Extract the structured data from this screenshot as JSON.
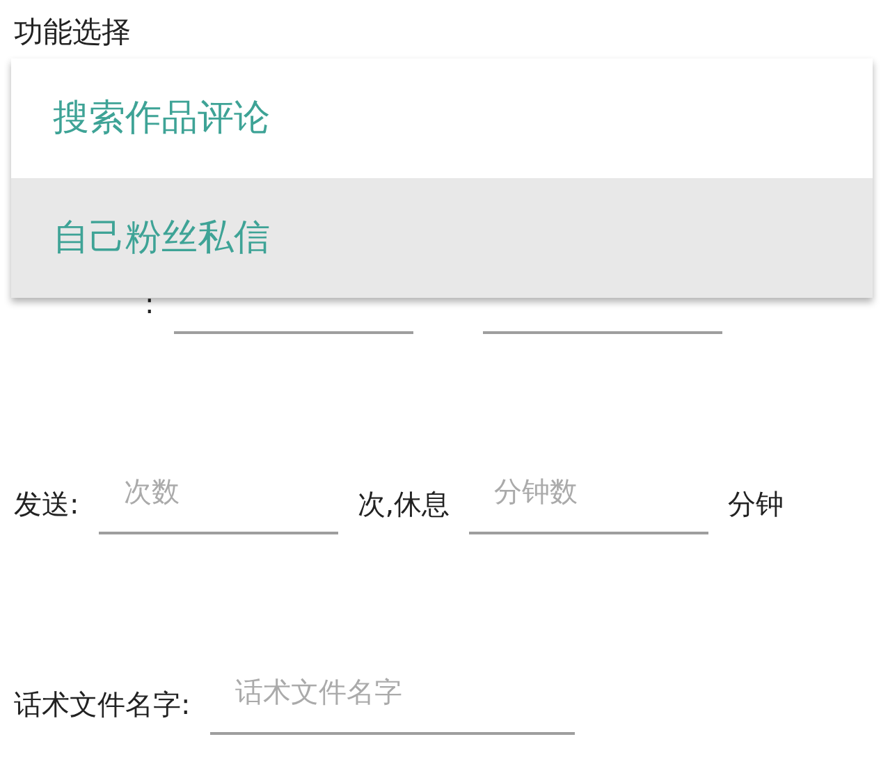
{
  "title": "功能选择",
  "dropdown": {
    "items": [
      {
        "label": "搜索作品评论",
        "selected": false
      },
      {
        "label": "自己粉丝私信",
        "selected": true
      }
    ]
  },
  "form": [
    {
      "parts": [
        {
          "kind": "label",
          "text": ":"
        },
        {
          "kind": "field"
        },
        {
          "kind": "field"
        }
      ]
    },
    {
      "parts": [
        {
          "kind": "label",
          "text": "发送:"
        },
        {
          "kind": "field",
          "placeholder": "次数"
        },
        {
          "kind": "label",
          "text": "次,休息"
        },
        {
          "kind": "field",
          "placeholder": "分钟数"
        },
        {
          "kind": "label",
          "text": "分钟"
        }
      ]
    },
    {
      "parts": [
        {
          "kind": "label",
          "text": "话术文件名字:"
        },
        {
          "kind": "long_field",
          "placeholder": "话术文件名字"
        }
      ]
    }
  ]
}
